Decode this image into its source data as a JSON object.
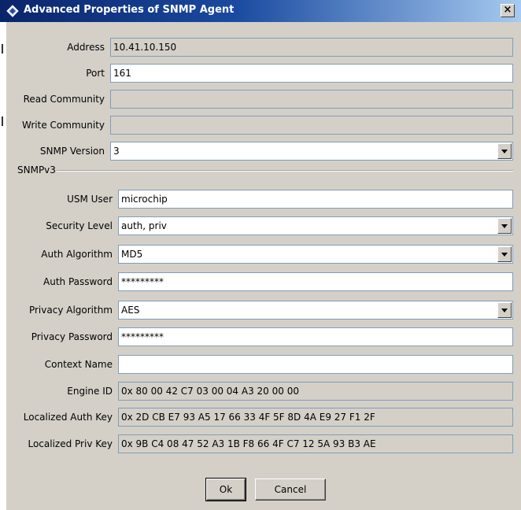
{
  "window": {
    "title": "Advanced Properties of SNMP Agent",
    "close_label": "×"
  },
  "fields": {
    "address": {
      "label": "Address",
      "value": "10.41.10.150"
    },
    "port": {
      "label": "Port",
      "value": "161"
    },
    "read_community": {
      "label": "Read Community",
      "value": ""
    },
    "write_community": {
      "label": "Write Community",
      "value": ""
    },
    "snmp_version": {
      "label": "SNMP Version",
      "value": "3"
    }
  },
  "snmpv3": {
    "section_label": "SNMPv3",
    "usm_user": {
      "label": "USM User",
      "value": "microchip"
    },
    "security_level": {
      "label": "Security Level",
      "value": "auth, priv"
    },
    "auth_algorithm": {
      "label": "Auth Algorithm",
      "value": "MD5"
    },
    "auth_password": {
      "label": "Auth Password",
      "value": "*********"
    },
    "privacy_algorithm": {
      "label": "Privacy Algorithm",
      "value": "AES"
    },
    "privacy_password": {
      "label": "Privacy Password",
      "value": "*********"
    },
    "context_name": {
      "label": "Context Name",
      "value": ""
    },
    "engine_id": {
      "label": "Engine ID",
      "value": "0x 80 00 42 C7 03 00 04 A3 20 00 00"
    },
    "localized_auth_key": {
      "label": "Localized Auth Key",
      "value": "0x 2D CB E7 93 A5 17 66 33 4F 5F 8D 4A E9 27 F1 2F"
    },
    "localized_priv_key": {
      "label": "Localized Priv Key",
      "value": "0x 9B C4 08 47 52 A3 1B F8 66 4F C7 12 5A 93 B3 AE"
    }
  },
  "buttons": {
    "ok": "Ok",
    "cancel": "Cancel"
  }
}
